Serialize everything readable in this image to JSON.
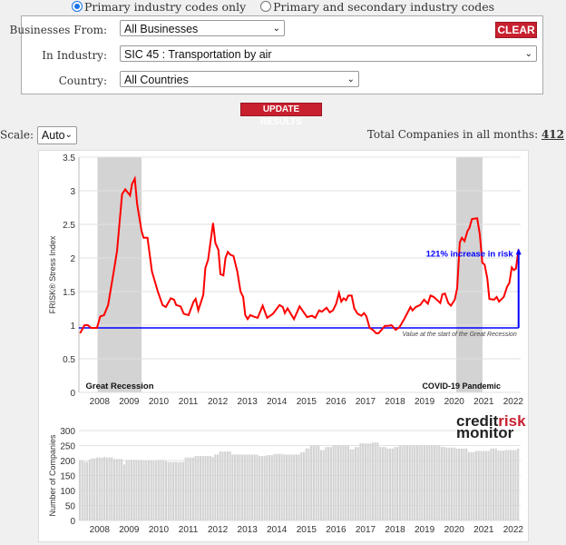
{
  "radios": [
    {
      "label": "Primary industry codes only",
      "selected": true
    },
    {
      "label": "Primary and secondary industry codes",
      "selected": false
    }
  ],
  "filters": {
    "businesses_label": "Businesses From:",
    "businesses_value": "All Businesses",
    "industry_label": "In Industry:",
    "industry_value": "SIC 45 : Transportation by air",
    "country_label": "Country:",
    "country_value": "All Countries",
    "clear_label": "CLEAR",
    "update_label": "UPDATE RESULTS"
  },
  "scale": {
    "label": "Scale:",
    "value": "Auto"
  },
  "total": {
    "label": "Total Companies in all months:",
    "value": "412"
  },
  "colors": {
    "accent": "#c8202f",
    "line": "#ff0000",
    "baseline": "#0000ff",
    "shade": "#d3d3d3",
    "bars": "#d3d3d3"
  },
  "logo": {
    "part1": "credit",
    "part2": "risk",
    "part3": "monitor"
  },
  "chart_data": [
    {
      "type": "line",
      "ylabel": "FRISK® Stress Index",
      "ylim": [
        0,
        3.5
      ],
      "yticks": [
        "0",
        "0.5",
        "1",
        "1.5",
        "2",
        "2.5",
        "3",
        "3.5"
      ],
      "xticks": [
        "2008",
        "2009",
        "2010",
        "2011",
        "2012",
        "2013",
        "2014",
        "2015",
        "2016",
        "2017",
        "2018",
        "2019",
        "2020",
        "2021",
        "2022"
      ],
      "grid": true,
      "shaded_regions": [
        {
          "label": "Great Recession",
          "from": 2007.93,
          "to": 2009.42
        },
        {
          "label": "COVID-19 Pandemic",
          "from": 2020.07,
          "to": 2020.96
        }
      ],
      "baseline": {
        "value": 0.96,
        "label": "Value at the start of the Great Recession"
      },
      "annotation": {
        "text": "121% increase in risk",
        "x": 2022.18,
        "from": 0.96,
        "to": 2.13
      },
      "series": [
        {
          "points": [
            [
              2007.34,
              0.88
            ],
            [
              2007.49,
              1.0
            ],
            [
              2007.6,
              1.0
            ],
            [
              2007.71,
              0.96
            ],
            [
              2007.91,
              0.96
            ],
            [
              2008.02,
              1.13
            ],
            [
              2008.15,
              1.15
            ],
            [
              2008.29,
              1.3
            ],
            [
              2008.48,
              1.8
            ],
            [
              2008.59,
              2.1
            ],
            [
              2008.76,
              2.95
            ],
            [
              2008.87,
              3.02
            ],
            [
              2009.03,
              2.93
            ],
            [
              2009.1,
              3.1
            ],
            [
              2009.19,
              3.18
            ],
            [
              2009.27,
              2.8
            ],
            [
              2009.42,
              2.4
            ],
            [
              2009.49,
              2.3
            ],
            [
              2009.62,
              2.3
            ],
            [
              2009.77,
              1.8
            ],
            [
              2009.97,
              1.5
            ],
            [
              2010.13,
              1.3
            ],
            [
              2010.24,
              1.27
            ],
            [
              2010.41,
              1.4
            ],
            [
              2010.52,
              1.38
            ],
            [
              2010.59,
              1.3
            ],
            [
              2010.74,
              1.28
            ],
            [
              2010.85,
              1.17
            ],
            [
              2011.01,
              1.15
            ],
            [
              2011.18,
              1.35
            ],
            [
              2011.25,
              1.39
            ],
            [
              2011.34,
              1.22
            ],
            [
              2011.51,
              1.45
            ],
            [
              2011.58,
              1.85
            ],
            [
              2011.67,
              1.97
            ],
            [
              2011.84,
              2.52
            ],
            [
              2011.92,
              2.22
            ],
            [
              2012.02,
              2.12
            ],
            [
              2012.09,
              1.76
            ],
            [
              2012.19,
              1.74
            ],
            [
              2012.26,
              2.0
            ],
            [
              2012.34,
              2.09
            ],
            [
              2012.42,
              2.05
            ],
            [
              2012.53,
              2.03
            ],
            [
              2012.66,
              1.8
            ],
            [
              2012.77,
              1.5
            ],
            [
              2012.86,
              1.42
            ],
            [
              2012.93,
              1.15
            ],
            [
              2013.01,
              1.09
            ],
            [
              2013.1,
              1.15
            ],
            [
              2013.21,
              1.13
            ],
            [
              2013.35,
              1.11
            ],
            [
              2013.52,
              1.29
            ],
            [
              2013.67,
              1.11
            ],
            [
              2013.87,
              1.17
            ],
            [
              2014.09,
              1.3
            ],
            [
              2014.2,
              1.27
            ],
            [
              2014.27,
              1.18
            ],
            [
              2014.36,
              1.25
            ],
            [
              2014.58,
              1.09
            ],
            [
              2014.77,
              1.28
            ],
            [
              2015.02,
              1.12
            ],
            [
              2015.19,
              1.14
            ],
            [
              2015.3,
              1.11
            ],
            [
              2015.43,
              1.22
            ],
            [
              2015.52,
              1.2
            ],
            [
              2015.68,
              1.26
            ],
            [
              2015.79,
              1.19
            ],
            [
              2015.9,
              1.22
            ],
            [
              2016.01,
              1.32
            ],
            [
              2016.1,
              1.48
            ],
            [
              2016.18,
              1.35
            ],
            [
              2016.26,
              1.4
            ],
            [
              2016.34,
              1.37
            ],
            [
              2016.42,
              1.44
            ],
            [
              2016.53,
              1.44
            ],
            [
              2016.62,
              1.25
            ],
            [
              2016.73,
              1.17
            ],
            [
              2016.86,
              1.14
            ],
            [
              2016.95,
              1.18
            ],
            [
              2017.03,
              1.13
            ],
            [
              2017.14,
              0.96
            ],
            [
              2017.25,
              0.93
            ],
            [
              2017.36,
              0.88
            ],
            [
              2017.44,
              0.88
            ],
            [
              2017.66,
              0.99
            ],
            [
              2017.77,
              0.99
            ],
            [
              2017.88,
              1.0
            ],
            [
              2018.02,
              0.93
            ],
            [
              2018.15,
              0.97
            ],
            [
              2018.32,
              1.1
            ],
            [
              2018.52,
              1.27
            ],
            [
              2018.59,
              1.22
            ],
            [
              2018.7,
              1.27
            ],
            [
              2018.85,
              1.3
            ],
            [
              2018.98,
              1.38
            ],
            [
              2019.11,
              1.32
            ],
            [
              2019.2,
              1.44
            ],
            [
              2019.31,
              1.42
            ],
            [
              2019.53,
              1.33
            ],
            [
              2019.6,
              1.46
            ],
            [
              2019.69,
              1.47
            ],
            [
              2019.8,
              1.33
            ],
            [
              2019.89,
              1.29
            ],
            [
              2020.02,
              1.38
            ],
            [
              2020.1,
              1.55
            ],
            [
              2020.19,
              2.23
            ],
            [
              2020.26,
              2.3
            ],
            [
              2020.35,
              2.25
            ],
            [
              2020.45,
              2.4
            ],
            [
              2020.52,
              2.45
            ],
            [
              2020.6,
              2.58
            ],
            [
              2020.78,
              2.59
            ],
            [
              2020.87,
              2.35
            ],
            [
              2020.95,
              1.93
            ],
            [
              2021.03,
              1.9
            ],
            [
              2021.12,
              1.7
            ],
            [
              2021.19,
              1.39
            ],
            [
              2021.35,
              1.38
            ],
            [
              2021.44,
              1.42
            ],
            [
              2021.52,
              1.35
            ],
            [
              2021.68,
              1.42
            ],
            [
              2021.79,
              1.57
            ],
            [
              2021.87,
              1.63
            ],
            [
              2021.95,
              1.86
            ],
            [
              2022.02,
              1.82
            ],
            [
              2022.09,
              1.84
            ],
            [
              2022.18,
              2.13
            ]
          ]
        }
      ]
    },
    {
      "type": "bar",
      "ylabel": "Number of Companies",
      "ylim": [
        0,
        300
      ],
      "yticks": [
        "0",
        "50",
        "100",
        "150",
        "200",
        "250",
        "300"
      ],
      "xticks": [
        "2008",
        "2009",
        "2010",
        "2011",
        "2012",
        "2013",
        "2014",
        "2015",
        "2016",
        "2017",
        "2018",
        "2019",
        "2020",
        "2021",
        "2022"
      ],
      "grid": true,
      "monthly_levels": [
        [
          2007.34,
          200
        ],
        [
          2007.5,
          196
        ],
        [
          2007.6,
          203
        ],
        [
          2007.75,
          207
        ],
        [
          2007.9,
          210
        ],
        [
          2008.1,
          212
        ],
        [
          2008.2,
          210
        ],
        [
          2008.5,
          205
        ],
        [
          2008.84,
          187
        ],
        [
          2008.92,
          202
        ],
        [
          2009.5,
          200
        ],
        [
          2010.0,
          202
        ],
        [
          2010.2,
          198
        ],
        [
          2010.3,
          195
        ],
        [
          2010.85,
          200
        ],
        [
          2010.9,
          210
        ],
        [
          2011.18,
          215
        ],
        [
          2011.78,
          212
        ],
        [
          2011.9,
          220
        ],
        [
          2012.05,
          230
        ],
        [
          2012.45,
          220
        ],
        [
          2013.37,
          215
        ],
        [
          2013.65,
          218
        ],
        [
          2013.87,
          222
        ],
        [
          2014.25,
          220
        ],
        [
          2014.8,
          228
        ],
        [
          2014.97,
          240
        ],
        [
          2015.13,
          250
        ],
        [
          2015.46,
          235
        ],
        [
          2015.63,
          245
        ],
        [
          2015.9,
          250
        ],
        [
          2016.5,
          237
        ],
        [
          2016.62,
          245
        ],
        [
          2016.84,
          258
        ],
        [
          2017.0,
          257
        ],
        [
          2017.22,
          260
        ],
        [
          2017.44,
          245
        ],
        [
          2017.71,
          240
        ],
        [
          2017.93,
          245
        ],
        [
          2018.15,
          250
        ],
        [
          2019.58,
          245
        ],
        [
          2019.75,
          243
        ],
        [
          2020.02,
          240
        ],
        [
          2020.46,
          228
        ],
        [
          2020.68,
          232
        ],
        [
          2021.18,
          240
        ],
        [
          2021.45,
          233
        ],
        [
          2021.73,
          235
        ],
        [
          2022.11,
          240
        ]
      ],
      "end": 2022.18
    }
  ]
}
